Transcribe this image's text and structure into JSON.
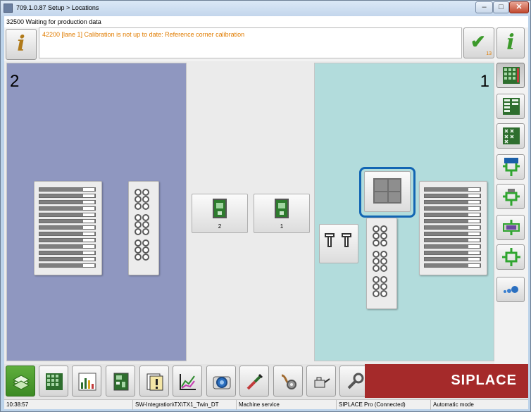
{
  "window": {
    "title": "709.1.0.87 Setup > Locations",
    "minimize_label": "–",
    "maximize_label": "□",
    "close_label": "✕"
  },
  "status_line": "32500 Waiting for production data",
  "message": {
    "text": "42200 [lane 1] Calibration is not up to date: Reference corner calibration",
    "ack_count": "13"
  },
  "lanes": {
    "left_number": "2",
    "right_number": "1"
  },
  "boards": [
    {
      "label": "2"
    },
    {
      "label": "1"
    }
  ],
  "sidebar": {
    "items": [
      "info-icon",
      "feeder-table-icon",
      "feeder-list-icon",
      "feeder-cross-icon",
      "camera-green-icon",
      "head-green-icon",
      "board-green-icon",
      "component-green-icon",
      "nozzle-blue-icon"
    ]
  },
  "toolbar": {
    "items": [
      "stack-icon",
      "grid-icon",
      "bar-chart-icon",
      "board-icon",
      "clipboard-warning-icon",
      "line-chart-icon",
      "camera-icon",
      "tool-icon",
      "hand-gear-icon",
      "oil-can-icon",
      "wrench-icon"
    ],
    "brand": "SIPLACE"
  },
  "footer": {
    "time": "10:38:57",
    "path": "SW-Integration\\TX\\TX1_Twin_DT",
    "service": "Machine service",
    "connection": "SIPLACE Pro (Connected)",
    "mode": "Automatic mode"
  },
  "colors": {
    "lane_left": "#8f97c0",
    "lane_right": "#b2dcdc",
    "message": "#e07c00",
    "brand_bg": "#a52a2a",
    "selection": "#1265b3"
  }
}
